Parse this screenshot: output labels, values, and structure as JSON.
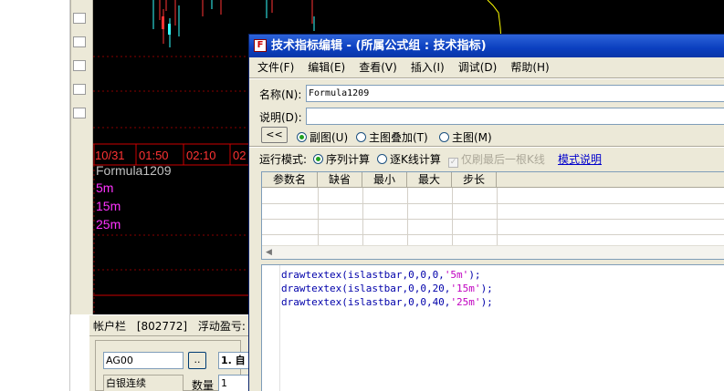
{
  "chart": {
    "time_ticks": [
      "10/31",
      "01:50",
      "02:10",
      "02"
    ],
    "formula_name": "Formula1209",
    "overlay_labels": [
      "5m",
      "15m",
      "25m"
    ],
    "colors": {
      "tick": "#ff3333",
      "formula": "#c0c0c0",
      "overlay": "#ff33ff",
      "up": "#ff3333",
      "down": "#33ffff",
      "line": "#ffff00"
    }
  },
  "account_bar": {
    "label": "帐户栏",
    "account_id": "[802772]",
    "floating_pnl_label": "浮动盈亏:",
    "floating_pnl_value": "-"
  },
  "account_panel": {
    "contract_code": "AG00",
    "browse_label": "..",
    "contract_name": "白银连续",
    "quantity_label": "数量",
    "quantity_value": "1",
    "option_text": "1. 自"
  },
  "dialog": {
    "title": "技术指标编辑 - (所属公式组 : 技术指标)",
    "icon_glyph": "F",
    "menu": [
      "文件(F)",
      "编辑(E)",
      "查看(V)",
      "插入(I)",
      "调试(D)",
      "帮助(H)"
    ],
    "name_label": "名称(N):",
    "name_value": "Formula1209",
    "desc_label": "说明(D):",
    "desc_value": "",
    "collapse_button": "<<",
    "display_options": [
      {
        "label": "副图(U)",
        "checked": true
      },
      {
        "label": "主图叠加(T)",
        "checked": false
      },
      {
        "label": "主图(M)",
        "checked": false
      }
    ],
    "run_mode_label": "运行模式:",
    "run_modes": [
      {
        "label": "序列计算",
        "checked": true
      },
      {
        "label": "逐K线计算",
        "checked": false
      }
    ],
    "last_bar_only_label": "仅刷最后一根K线",
    "mode_help_link": "模式说明",
    "param_columns": [
      "参数名",
      "缺省",
      "最小",
      "最大",
      "步长"
    ],
    "code_lines": [
      [
        "drawtextex(islastbar,0,0,0,",
        "'5m'",
        ");"
      ],
      [
        "drawtextex(islastbar,0,0,20,",
        "'15m'",
        ");"
      ],
      [
        "drawtextex(islastbar,0,0,40,",
        "'25m'",
        ");"
      ]
    ]
  }
}
